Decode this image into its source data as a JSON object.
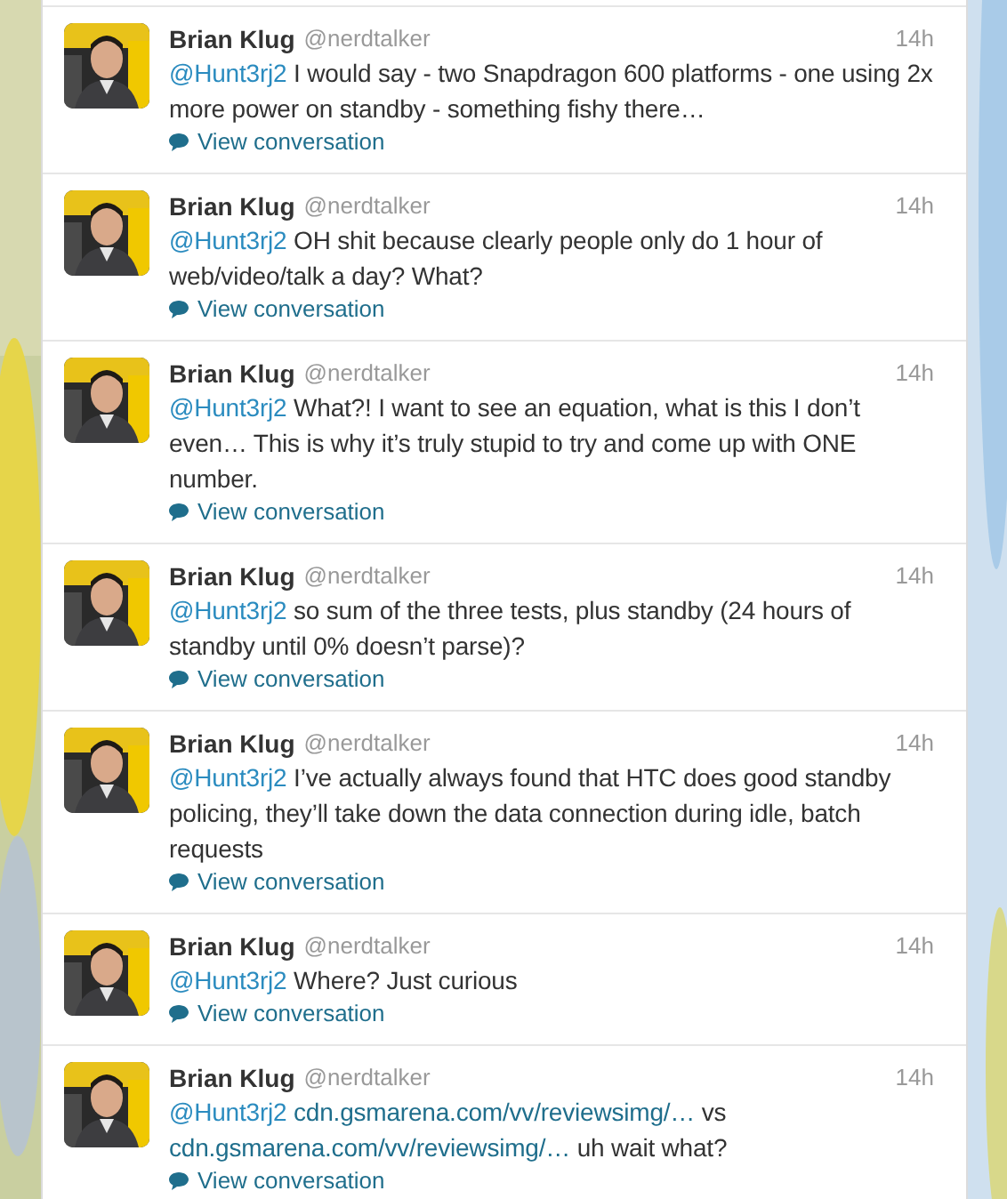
{
  "tweets": [
    {
      "name": "Brian Klug",
      "handle": "@nerdtalker",
      "time": "14h",
      "text": [
        {
          "kind": "mention",
          "text": "@Hunt3rj2"
        },
        {
          "kind": "text",
          "text": "I would say - two Snapdragon 600 platforms - one using 2x more power on standby - something fishy there…"
        }
      ],
      "action": "View conversation"
    },
    {
      "name": "Brian Klug",
      "handle": "@nerdtalker",
      "time": "14h",
      "text": [
        {
          "kind": "mention",
          "text": "@Hunt3rj2"
        },
        {
          "kind": "text",
          "text": "OH shit because clearly people only do 1 hour of web/video/talk a day? What?"
        }
      ],
      "action": "View conversation"
    },
    {
      "name": "Brian Klug",
      "handle": "@nerdtalker",
      "time": "14h",
      "text": [
        {
          "kind": "mention",
          "text": "@Hunt3rj2"
        },
        {
          "kind": "text",
          "text": "What?! I want to see an equation, what is this I don’t even… This is why it’s truly stupid to try and come up with ONE number."
        }
      ],
      "action": "View conversation"
    },
    {
      "name": "Brian Klug",
      "handle": "@nerdtalker",
      "time": "14h",
      "text": [
        {
          "kind": "mention",
          "text": "@Hunt3rj2"
        },
        {
          "kind": "text",
          "text": "so sum of the three tests, plus standby (24 hours of standby until 0% doesn’t parse)?"
        }
      ],
      "action": "View conversation"
    },
    {
      "name": "Brian Klug",
      "handle": "@nerdtalker",
      "time": "14h",
      "text": [
        {
          "kind": "mention",
          "text": "@Hunt3rj2"
        },
        {
          "kind": "text",
          "text": "I’ve actually always found that HTC does good standby policing, they’ll take down the data connection during idle, batch requests"
        }
      ],
      "action": "View conversation"
    },
    {
      "name": "Brian Klug",
      "handle": "@nerdtalker",
      "time": "14h",
      "text": [
        {
          "kind": "mention",
          "text": "@Hunt3rj2"
        },
        {
          "kind": "text",
          "text": "Where? Just curious"
        }
      ],
      "action": "View conversation"
    },
    {
      "name": "Brian Klug",
      "handle": "@nerdtalker",
      "time": "14h",
      "text": [
        {
          "kind": "mention",
          "text": "@Hunt3rj2"
        },
        {
          "kind": "link",
          "text": "cdn.gsmarena.com/vv/reviewsimg/…"
        },
        {
          "kind": "text",
          "text": "vs"
        },
        {
          "kind": "link",
          "text": "cdn.gsmarena.com/vv/reviewsimg/…"
        },
        {
          "kind": "text",
          "text": "uh wait what?"
        }
      ],
      "action": "View conversation"
    }
  ]
}
